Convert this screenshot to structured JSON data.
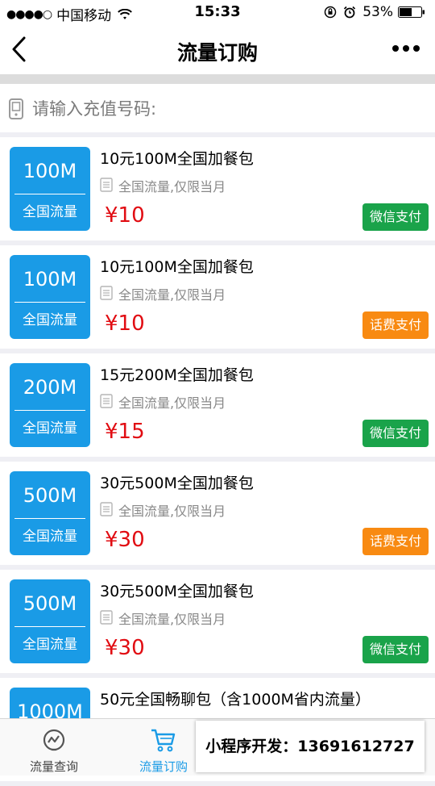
{
  "status_bar": {
    "carrier": "中国移动",
    "time": "15:33",
    "battery": "53%"
  },
  "nav": {
    "title": "流量订购"
  },
  "phone_input": {
    "placeholder": "请输入充值号码:"
  },
  "colors": {
    "badge": "#1a9be6",
    "price": "#e10c12",
    "wechat_pay": "#1aa34a",
    "phone_bill_pay": "#f88a12",
    "tab_active": "#1a9be6"
  },
  "products": [
    {
      "size": "100M",
      "scope": "全国流量",
      "name": "10元100M全国加餐包",
      "desc": "全国流量,仅限当月",
      "price": "¥10",
      "pay": "微信支付",
      "pay_type": "wechat"
    },
    {
      "size": "100M",
      "scope": "全国流量",
      "name": "10元100M全国加餐包",
      "desc": "全国流量,仅限当月",
      "price": "¥10",
      "pay": "话费支付",
      "pay_type": "bill"
    },
    {
      "size": "200M",
      "scope": "全国流量",
      "name": "15元200M全国加餐包",
      "desc": "全国流量,仅限当月",
      "price": "¥15",
      "pay": "微信支付",
      "pay_type": "wechat"
    },
    {
      "size": "500M",
      "scope": "全国流量",
      "name": "30元500M全国加餐包",
      "desc": "全国流量,仅限当月",
      "price": "¥30",
      "pay": "话费支付",
      "pay_type": "bill"
    },
    {
      "size": "500M",
      "scope": "全国流量",
      "name": "30元500M全国加餐包",
      "desc": "全国流量,仅限当月",
      "price": "¥30",
      "pay": "微信支付",
      "pay_type": "wechat"
    },
    {
      "size": "1000M",
      "scope": "",
      "name": "50元全国畅聊包（含1000M省内流量）",
      "desc": "",
      "price": "",
      "pay": "",
      "pay_type": ""
    }
  ],
  "tabs": [
    {
      "label": "流量查询",
      "icon": "gauge-icon",
      "active": false
    },
    {
      "label": "流量订购",
      "icon": "cart-icon",
      "active": true
    }
  ],
  "promo": {
    "text": "小程序开发：13691612727"
  }
}
